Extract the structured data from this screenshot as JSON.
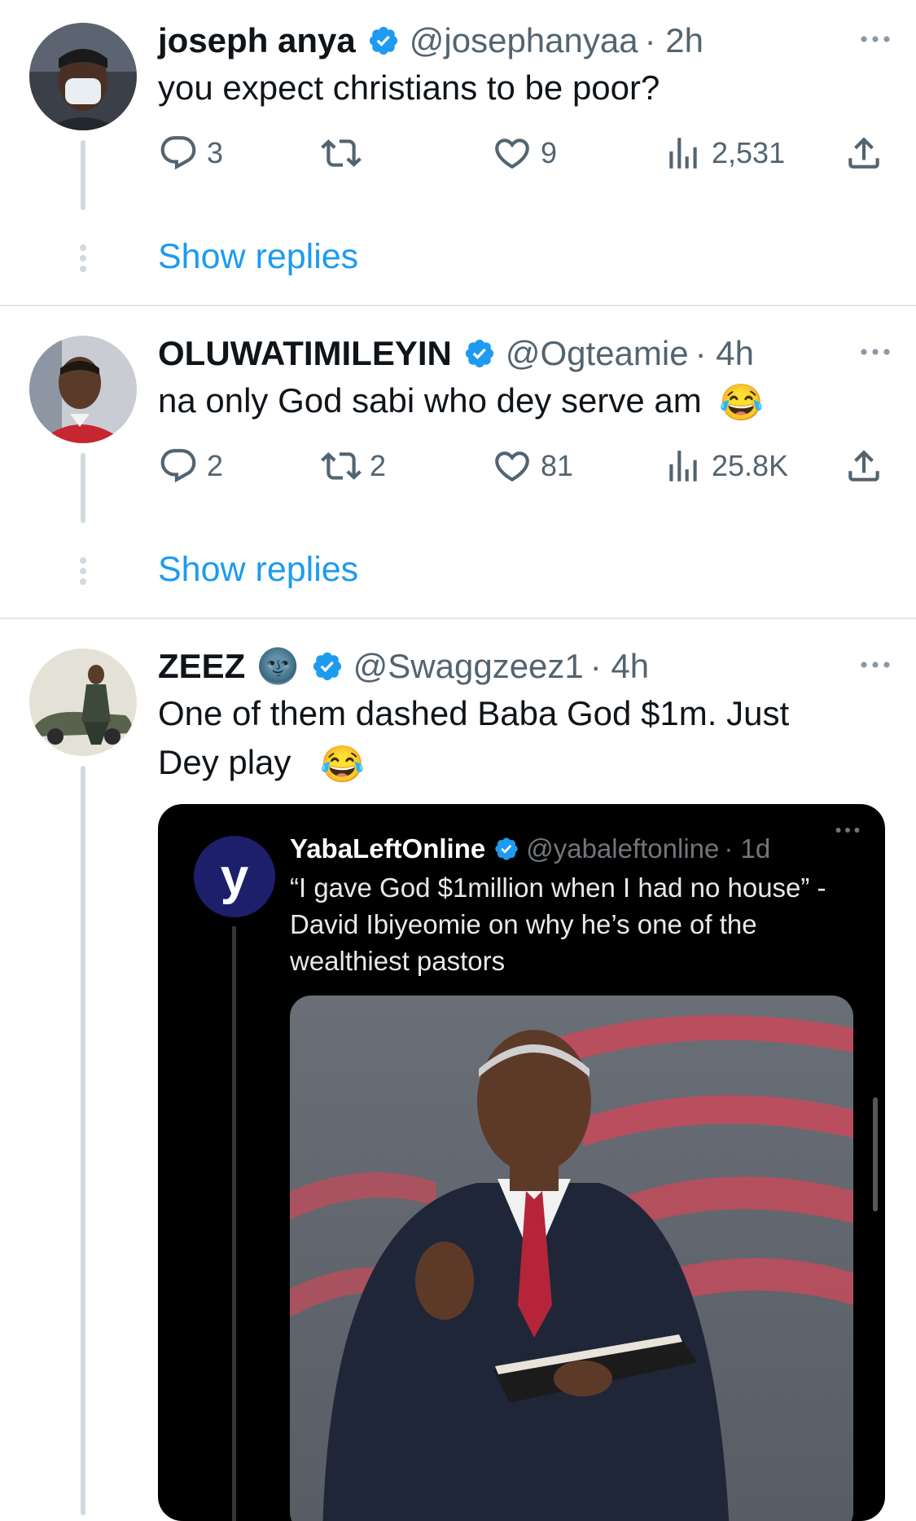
{
  "tweets": [
    {
      "name": "joseph anya",
      "handle": "@josephanyaa",
      "time": "· 2h",
      "text": "you expect christians to be poor?",
      "replies": "3",
      "retweets": "",
      "likes": "9",
      "views": "2,531",
      "show_replies": "Show replies",
      "icons": [
        "reply-icon",
        "retweet-icon",
        "like-icon",
        "views-icon",
        "share-icon"
      ]
    },
    {
      "name": "OLUWATIMILEYIN",
      "handle": "@Ogteamie",
      "time": "· 4h",
      "text": "na only God sabi who dey serve am",
      "emoji": "😂",
      "replies": "2",
      "retweets": "2",
      "likes": "81",
      "views": "25.8K",
      "show_replies": "Show replies"
    },
    {
      "name": "ZEEZ",
      "name_emoji": "🌚",
      "handle": "@Swaggzeez1",
      "time": "· 4h",
      "text_line1": "One of them dashed Baba God $1m. Just",
      "text_line2": "Dey play",
      "emoji": "😂",
      "quoted": {
        "avatar_letter": "y",
        "name": "YabaLeftOnline",
        "handle": "@yabaleftonline",
        "time": "· 1d",
        "text": "“I gave God $1million when I had no house” - David Ibiyeomie on why he’s one of the wealthiest pastors"
      }
    }
  ],
  "colors": {
    "accent": "#1d9bf0",
    "secondary_text": "#536471",
    "divider": "#e2e6e9"
  }
}
